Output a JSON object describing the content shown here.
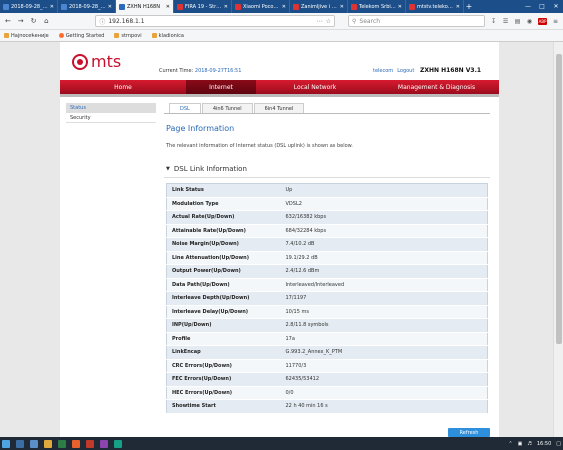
{
  "browser": {
    "tabs": [
      {
        "title": "2018-09-28_15-46",
        "favicon": "blue",
        "active": false
      },
      {
        "title": "2018-09-28_16-4",
        "favicon": "blue",
        "active": false
      },
      {
        "title": "ZXHN H168N",
        "favicon": "zte",
        "active": true
      },
      {
        "title": "FIRA 19 - Stranic",
        "favicon": "red",
        "active": false
      },
      {
        "title": "Xiaomi Pocopho",
        "favicon": "red",
        "active": false
      },
      {
        "title": "Zanimljive i smes",
        "favicon": "red",
        "active": false
      },
      {
        "title": "Telekom Srbija -",
        "favicon": "red",
        "active": false
      },
      {
        "title": "mtstv.telekom.rs/EPG",
        "favicon": "red",
        "active": false
      }
    ],
    "url": "192.168.1.1",
    "search_placeholder": "Search",
    "bookmarks": [
      "Најпосећеније",
      "Getting Started",
      "strnpovi",
      "kladionica"
    ]
  },
  "header": {
    "logo_text": "mts",
    "current_time_label": "Current Time:",
    "current_time_value": "2018-09-27T16:51",
    "user": "telecom",
    "logout": "Logout",
    "model": "ZXHN H168N V3.1"
  },
  "main_nav": [
    {
      "label": "Home",
      "active": false
    },
    {
      "label": "Internet",
      "active": true
    },
    {
      "label": "Local Network",
      "active": false
    },
    {
      "label": "Management & Diagnosis",
      "active": false
    }
  ],
  "sidebar": [
    {
      "label": "Status",
      "active": true
    },
    {
      "label": "Security",
      "active": false
    }
  ],
  "subtabs": [
    {
      "label": "DSL",
      "active": true
    },
    {
      "label": "4in6 Tunnel",
      "active": false
    },
    {
      "label": "6in4 Tunnel",
      "active": false
    }
  ],
  "page": {
    "title": "Page Information",
    "description": "The relevant information of Internet status (DSL uplink) is shown as below.",
    "section_title": "DSL Link Information"
  },
  "dsl_info": [
    {
      "key": "Link Status",
      "value": "Up"
    },
    {
      "key": "Modulation Type",
      "value": "VDSL2"
    },
    {
      "key": "Actual Rate(Up/Down)",
      "value": "632/16382 kbps"
    },
    {
      "key": "Attainable Rate(Up/Down)",
      "value": "684/32284 kbps"
    },
    {
      "key": "Noise Margin(Up/Down)",
      "value": "7.4/10.2 dB"
    },
    {
      "key": "Line Attenuation(Up/Down)",
      "value": "19.1/29.2 dB"
    },
    {
      "key": "Output Power(Up/Down)",
      "value": "2.4/12.6 dBm"
    },
    {
      "key": "Data Path(Up/Down)",
      "value": "Interleaved/Interleaved"
    },
    {
      "key": "Interleave Depth(Up/Down)",
      "value": "17/1197"
    },
    {
      "key": "Interleave Delay(Up/Down)",
      "value": "10/15 ms"
    },
    {
      "key": "INP(Up/Down)",
      "value": "2.8/11.8 symbols"
    },
    {
      "key": "Profile",
      "value": "17a"
    },
    {
      "key": "LinkEncap",
      "value": "G.993.2_Annex_K_PTM"
    },
    {
      "key": "CRC Errors(Up/Down)",
      "value": "11770/3"
    },
    {
      "key": "FEC Errors(Up/Down)",
      "value": "62435/53412"
    },
    {
      "key": "HEC Errors(Up/Down)",
      "value": "0/0"
    },
    {
      "key": "Showtime Start",
      "value": "22 h 40 min 16 s"
    }
  ],
  "refresh_label": "Refresh",
  "taskbar": {
    "clock": "16:50"
  },
  "colors": {
    "brand_red": "#c8102e",
    "link_blue": "#2a6ab8",
    "tab_bar": "#1c4f8a"
  }
}
